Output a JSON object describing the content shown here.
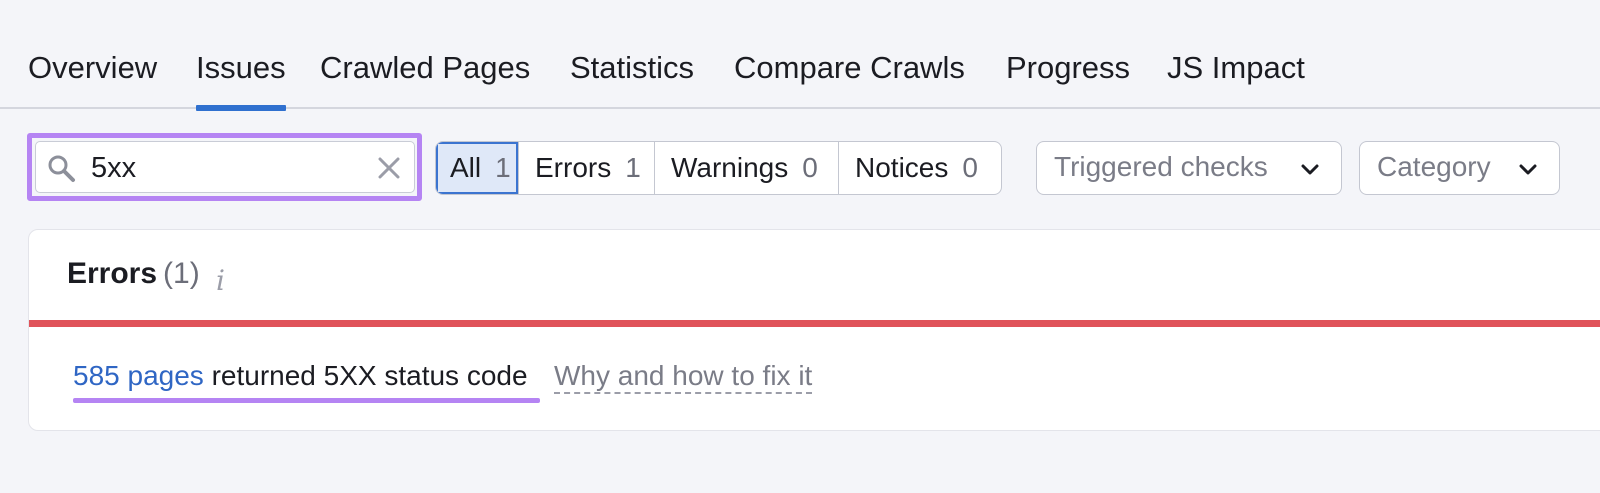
{
  "tabs": [
    {
      "label": "Overview",
      "active": false
    },
    {
      "label": "Issues",
      "active": true
    },
    {
      "label": "Crawled Pages",
      "active": false
    },
    {
      "label": "Statistics",
      "active": false
    },
    {
      "label": "Compare Crawls",
      "active": false
    },
    {
      "label": "Progress",
      "active": false
    },
    {
      "label": "JS Impact",
      "active": false
    }
  ],
  "search": {
    "value": "5xx",
    "icon": "search-icon",
    "clear_icon": "close-icon"
  },
  "filters": [
    {
      "label": "All",
      "count": "1",
      "active": true
    },
    {
      "label": "Errors",
      "count": "1",
      "active": false
    },
    {
      "label": "Warnings",
      "count": "0",
      "active": false
    },
    {
      "label": "Notices",
      "count": "0",
      "active": false
    }
  ],
  "dropdowns": [
    {
      "label": "Triggered checks",
      "icon": "chevron-down-icon"
    },
    {
      "label": "Category",
      "icon": "chevron-down-icon"
    }
  ],
  "errors_section": {
    "title": "Errors",
    "count": "(1)",
    "info_icon": "info-icon"
  },
  "issue": {
    "link_text": "585 pages",
    "text": " returned 5XX status code",
    "help_link": "Why and how to fix it"
  },
  "colors": {
    "accent": "#2f70cf",
    "highlight": "#b584f3",
    "error": "#e0535a",
    "background": "#f4f5f9"
  }
}
